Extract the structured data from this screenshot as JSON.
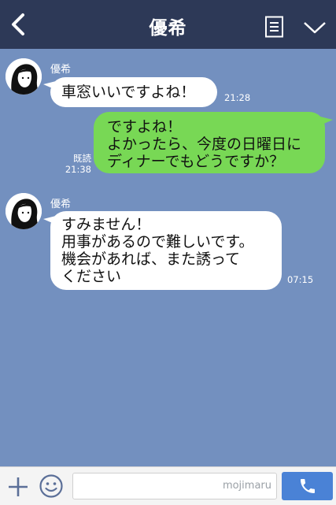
{
  "header": {
    "title": "優希"
  },
  "messages": [
    {
      "sender": "優希",
      "text": "車窓いいですよね！",
      "time": "21:28"
    },
    {
      "text": "ですよね！\nよかったら、今度の日曜日に\nディナーでもどうですか？",
      "read_label": "既読",
      "time": "21:38"
    },
    {
      "sender": "優希",
      "text": "すみません！\n用事があるので難しいです。\n機会があれば、また誘って\nください",
      "time": "07:15"
    }
  ],
  "footer": {
    "input_placeholder": "mojimaru"
  },
  "colors": {
    "header_bg": "#2d3957",
    "chat_bg": "#7390bf",
    "my_bubble": "#78d855",
    "their_bubble": "#ffffff",
    "call_button": "#4a82d6"
  }
}
